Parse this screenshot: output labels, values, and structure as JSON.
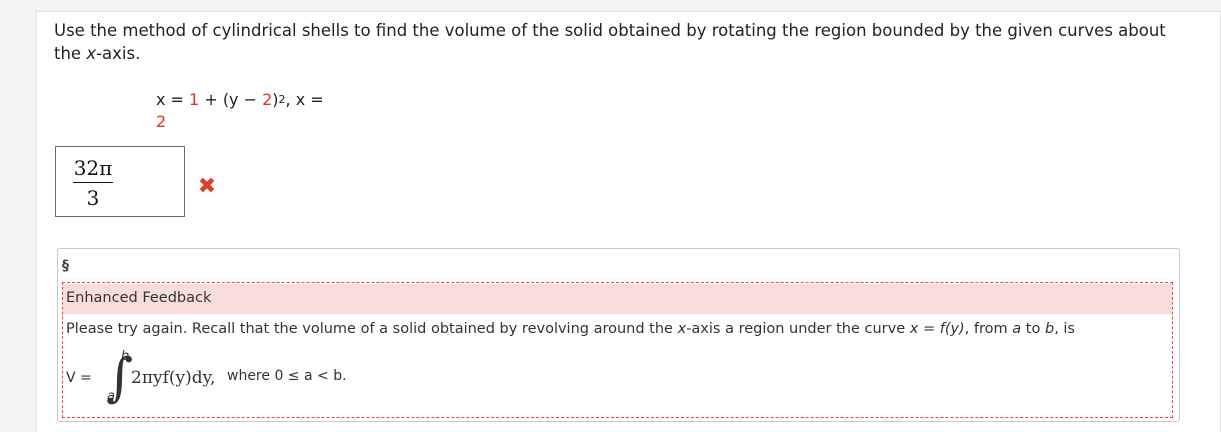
{
  "question": {
    "text_before": "Use the method of cylindrical shells to find the volume of the solid obtained by rotating the region bounded by the given curves about the ",
    "axis_var": "x",
    "text_after": "-axis."
  },
  "equation": {
    "line1_prefix": "x = ",
    "line1_const": "1",
    "line1_mid": " + (y − ",
    "line1_shift": "2",
    "line1_close": ")",
    "line1_exp": "2",
    "line1_suffix": ",  x =",
    "line2_value": "2"
  },
  "answer": {
    "numerator": "32π",
    "denominator": "3",
    "status": "incorrect"
  },
  "feedback": {
    "section_symbol": "§",
    "title": "Enhanced Feedback",
    "body_prefix": "Please try again. Recall that the volume of a solid obtained by revolving around the ",
    "body_axis": "x",
    "body_mid": "-axis a region under the curve ",
    "body_curve": "x = f(y)",
    "body_from": ", from ",
    "body_a": "a",
    "body_to": " to ",
    "body_b": "b",
    "body_end": ", is",
    "formula_lhs": "V =",
    "upper_limit": "b",
    "lower_limit": "a",
    "integrand": "2πyf(y)dy,",
    "condition": "where 0 ≤ a < b."
  },
  "colors": {
    "accent_red": "#e0301e",
    "feedback_bg": "#f9dcdc",
    "wrong_mark": "#d9412f"
  },
  "icons": {
    "wrong_mark": "x-mark-icon"
  }
}
